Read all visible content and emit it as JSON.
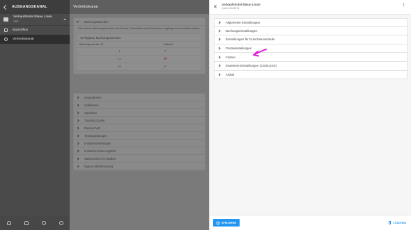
{
  "sidebar": {
    "title": "AUSGANGSKANAL",
    "hotel": {
      "name": "Verkaufshotel Blaue Linde",
      "sub": "HBE"
    },
    "items": [
      {
        "label": "Backoffice",
        "icon": "grid-icon"
      },
      {
        "label": "Vertriebskanal",
        "icon": "share-icon"
      }
    ],
    "footer_icons": [
      "user-icon",
      "bell-icon",
      "help-icon",
      "power-icon"
    ]
  },
  "page": {
    "title": "Vertriebskanal",
    "section_open": "Buchungsstrecken",
    "description": "Hier können Buchungsstrecken für Zimmer, Pauschalen und Gutscheine angelegt und verwaltet werden.",
    "inner_title": "Verfügbare Buchungsstrecken",
    "table": {
      "headers": [
        "Buchungsstrecken ID",
        "Aktiviert"
      ],
      "rows": [
        {
          "id": "1",
          "active": true
        },
        {
          "id": "12",
          "active": false
        },
        {
          "id": "23",
          "active": true
        }
      ]
    },
    "accordions": [
      "Integrationen",
      "Indikatoren",
      "Sprachen",
      "Tracking Codes",
      "Datenschutz",
      "Textanpassungen",
      "E-Mail-Einstellungen",
      "E-Mail-Erscheinungsbild",
      "Saisonzeiten für Medien",
      "Eigene Klassifizierung"
    ]
  },
  "drawer": {
    "title": "Verkaufshotel Blaue Linde",
    "subtitle": "Hotel #1245674",
    "items": [
      "Allgemeine Einstellungen",
      "Buchungseinstellungen",
      "Einstellungen für Gutscheinverkäufe",
      "Portaleinstellungen",
      "Farben",
      "Erweiterte Einstellungen (CSS/LESS)",
      "Artikel"
    ],
    "save_label": "SPEICHERN",
    "delete_label": "LÖSCHEN",
    "accent": "#2196f3",
    "annotation_color": "#e01bd6"
  }
}
